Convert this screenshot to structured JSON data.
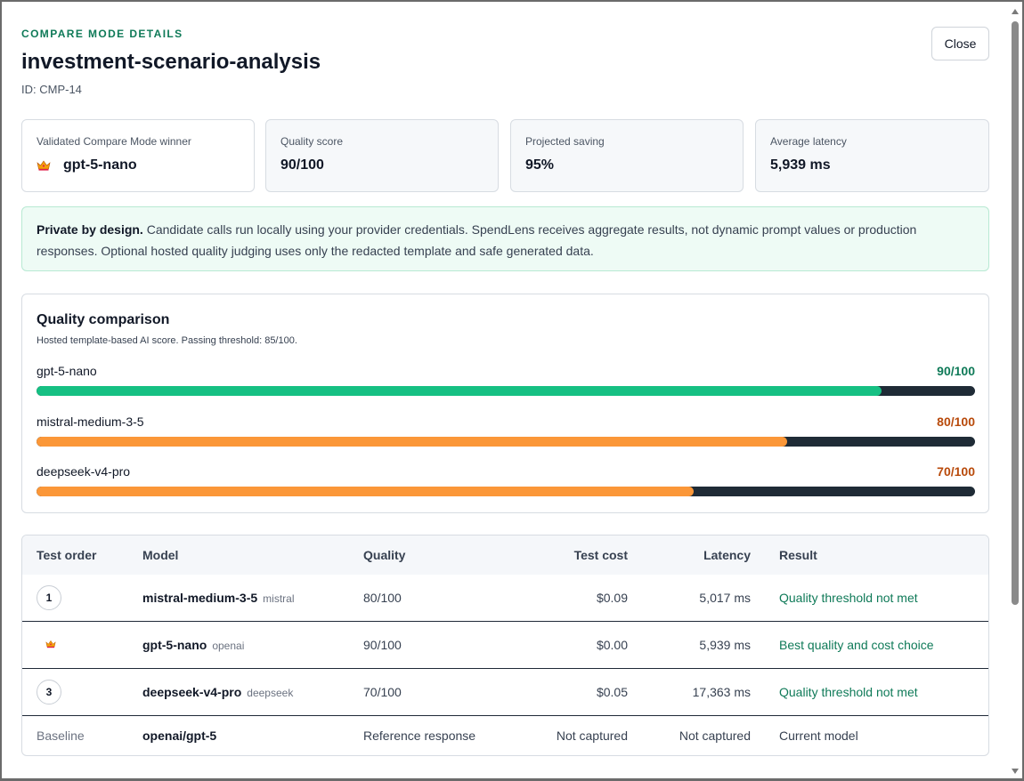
{
  "header": {
    "eyebrow": "COMPARE MODE DETAILS",
    "title": "investment-scenario-analysis",
    "id_text": "ID: CMP-14",
    "close_label": "Close"
  },
  "stats": [
    {
      "label": "Validated Compare Mode winner",
      "value": "gpt-5-nano",
      "icon": "crown-icon"
    },
    {
      "label": "Quality score",
      "value": "90/100"
    },
    {
      "label": "Projected saving",
      "value": "95%"
    },
    {
      "label": "Average latency",
      "value": "5,939 ms"
    }
  ],
  "privacy": {
    "strong": "Private by design.",
    "text": " Candidate calls run locally using your provider credentials. SpendLens receives aggregate results, not dynamic prompt values or production responses. Optional hosted quality judging uses only the redacted template and safe generated data."
  },
  "quality": {
    "title": "Quality comparison",
    "subtitle": "Hosted template-based AI score. Passing threshold: 85/100.",
    "rows": [
      {
        "name": "gpt-5-nano",
        "score_label": "90/100",
        "score": 90,
        "color": "#16c083",
        "score_color": "#0f7a58"
      },
      {
        "name": "mistral-medium-3-5",
        "score_label": "80/100",
        "score": 80,
        "color": "#fb9738",
        "score_color": "#b84a0b"
      },
      {
        "name": "deepseek-v4-pro",
        "score_label": "70/100",
        "score": 70,
        "color": "#fb9738",
        "score_color": "#b84a0b"
      }
    ]
  },
  "table": {
    "headers": {
      "order": "Test order",
      "model": "Model",
      "quality": "Quality",
      "cost": "Test cost",
      "latency": "Latency",
      "result": "Result"
    },
    "rows": [
      {
        "order": "1",
        "model": "mistral-medium-3-5",
        "provider": "mistral",
        "quality": "80/100",
        "cost": "$0.09",
        "latency": "5,017 ms",
        "result": "Quality threshold not met"
      },
      {
        "order": "",
        "model": "gpt-5-nano",
        "provider": "openai",
        "quality": "90/100",
        "cost": "$0.00",
        "latency": "5,939 ms",
        "result": "Best quality and cost choice"
      },
      {
        "order": "3",
        "model": "deepseek-v4-pro",
        "provider": "deepseek",
        "quality": "70/100",
        "cost": "$0.05",
        "latency": "17,363 ms",
        "result": "Quality threshold not met"
      }
    ],
    "baseline": {
      "order": "Baseline",
      "model": "openai/gpt-5",
      "quality": "Reference response",
      "cost": "Not captured",
      "latency": "Not captured",
      "result": "Current model"
    }
  }
}
